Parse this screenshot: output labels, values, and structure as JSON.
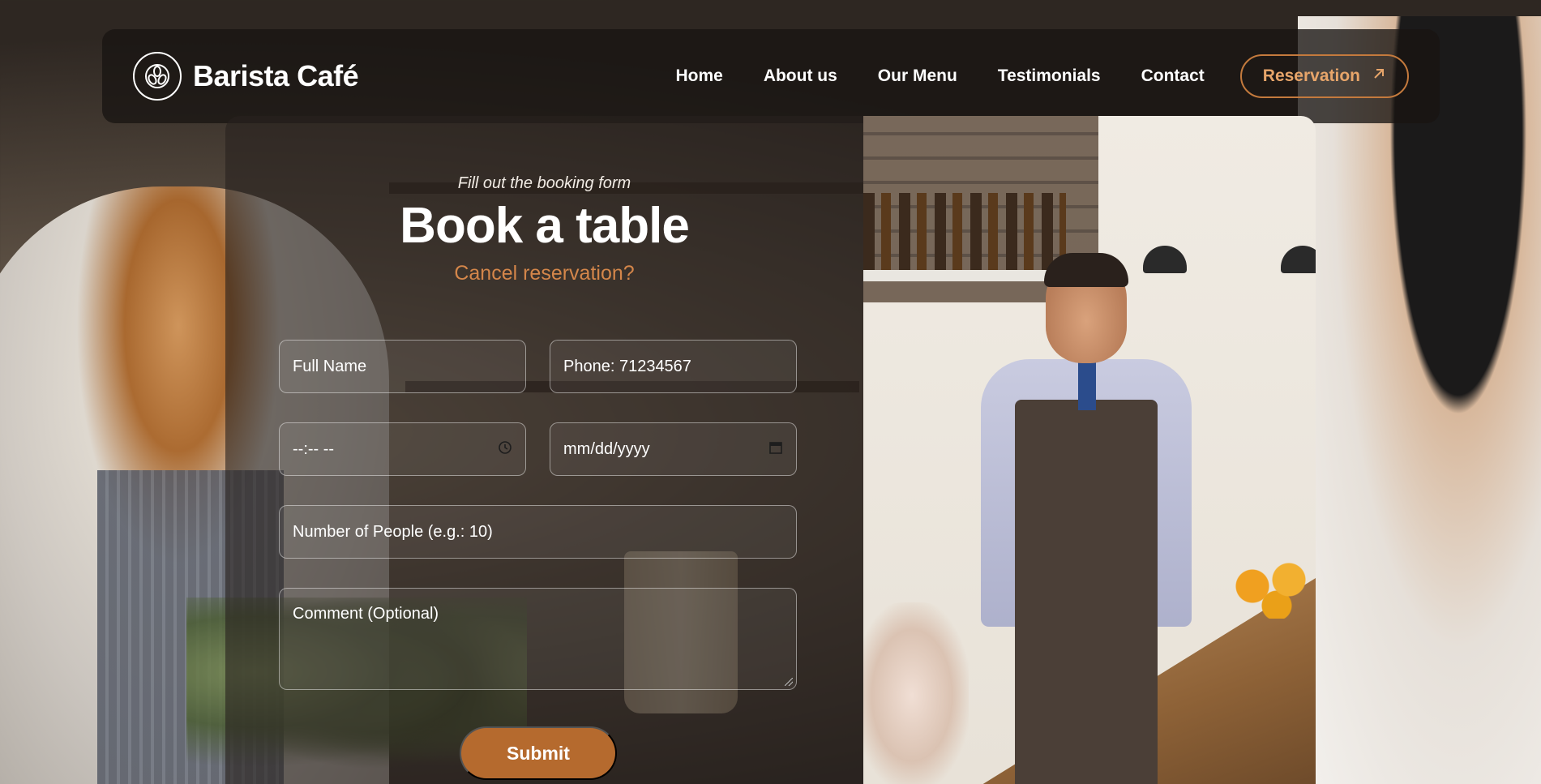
{
  "brand": {
    "name": "Barista Café",
    "logo_icon": "coffee-beans-icon"
  },
  "nav": {
    "links": [
      "Home",
      "About us",
      "Our Menu",
      "Testimonials",
      "Contact"
    ],
    "cta_label": "Reservation",
    "cta_icon": "arrow-up-right-icon"
  },
  "booking": {
    "subtitle": "Fill out the booking form",
    "title": "Book a table",
    "cancel_link": "Cancel reservation?",
    "fields": {
      "full_name_placeholder": "Full Name",
      "phone_placeholder": "Phone: 71234567",
      "time_placeholder": "--:-- --",
      "date_placeholder": "mm/dd/yyyy",
      "people_placeholder": "Number of People (e.g.: 10)",
      "comment_placeholder": "Comment (Optional)"
    },
    "submit_label": "Submit"
  },
  "colors": {
    "accent": "#b56a2e",
    "accent_text": "#e7a56a",
    "link": "#d4864a"
  }
}
